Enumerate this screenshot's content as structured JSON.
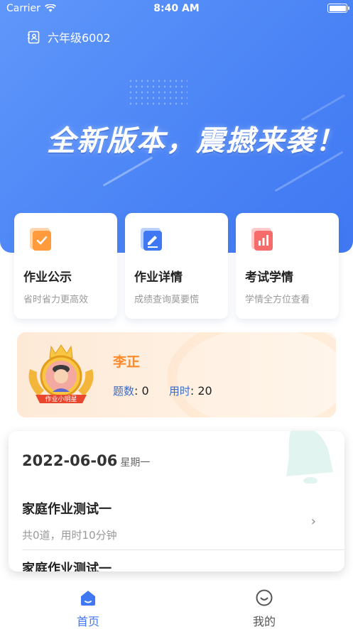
{
  "status_bar": {
    "carrier": "Carrier",
    "time": "8:40 AM"
  },
  "header": {
    "class_name": "六年级6002",
    "banner_title": "全新版本，震撼来袭！"
  },
  "feature_cards": [
    {
      "title": "作业公示",
      "subtitle": "省时省力更高效",
      "icon": "approval-doc-icon",
      "color": "#ffa24b"
    },
    {
      "title": "作业详情",
      "subtitle": "成绩查询莫要慌",
      "icon": "edit-doc-icon",
      "color": "#4a7ff5"
    },
    {
      "title": "考试学情",
      "subtitle": "学情全方位查看",
      "icon": "bar-chart-doc-icon",
      "color": "#f76b6b"
    }
  ],
  "star_card": {
    "badge_text": "作业小明星",
    "name": "李正",
    "count_label": "题数",
    "count_value": "0",
    "time_label": "用时",
    "time_value": "20"
  },
  "homework": {
    "date": "2022-06-06",
    "weekday": "星期一",
    "items": [
      {
        "title": "家庭作业测试一",
        "subtitle": "共0道，用时10分钟"
      },
      {
        "title": "家庭作业测试一"
      }
    ]
  },
  "tabbar": {
    "tabs": [
      {
        "label": "首页",
        "icon": "home-icon",
        "active": true
      },
      {
        "label": "我的",
        "icon": "smile-profile-icon",
        "active": false
      }
    ],
    "active_color": "#3f78f2",
    "inactive_color": "#555555"
  }
}
